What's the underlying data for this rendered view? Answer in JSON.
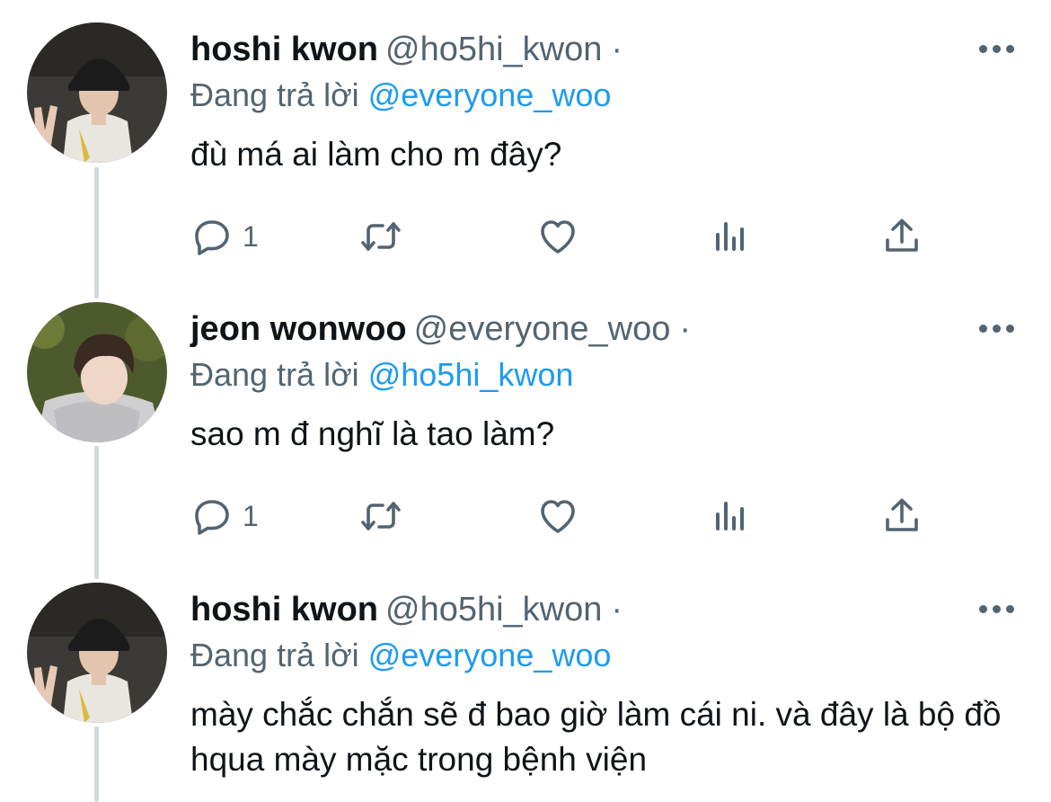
{
  "tweets": [
    {
      "name": "hoshi kwon",
      "handle": "@ho5hi_kwon",
      "separator": "·",
      "reply_prefix": "Đang trả lời",
      "reply_to": "@everyone_woo",
      "text": "đù má ai làm cho m đây?",
      "reply_count": "1"
    },
    {
      "name": "jeon wonwoo",
      "handle": "@everyone_woo",
      "separator": "·",
      "reply_prefix": "Đang trả lời",
      "reply_to": "@ho5hi_kwon",
      "text": "sao m đ nghĩ là tao làm?",
      "reply_count": "1"
    },
    {
      "name": "hoshi kwon",
      "handle": "@ho5hi_kwon",
      "separator": "·",
      "reply_prefix": "Đang trả lời",
      "reply_to": "@everyone_woo",
      "text": "mày chắc chắn sẽ đ bao giờ làm cái ni. và đây là bộ đồ hqua mày mặc trong bệnh viện"
    }
  ],
  "colors": {
    "accent": "#1d9bf0",
    "secondary_text": "#536471",
    "primary_text": "#0f1419",
    "thread_line": "#cfd9de"
  },
  "icons": [
    "reply-icon",
    "retweet-icon",
    "like-icon",
    "views-icon",
    "share-icon",
    "more-icon"
  ]
}
